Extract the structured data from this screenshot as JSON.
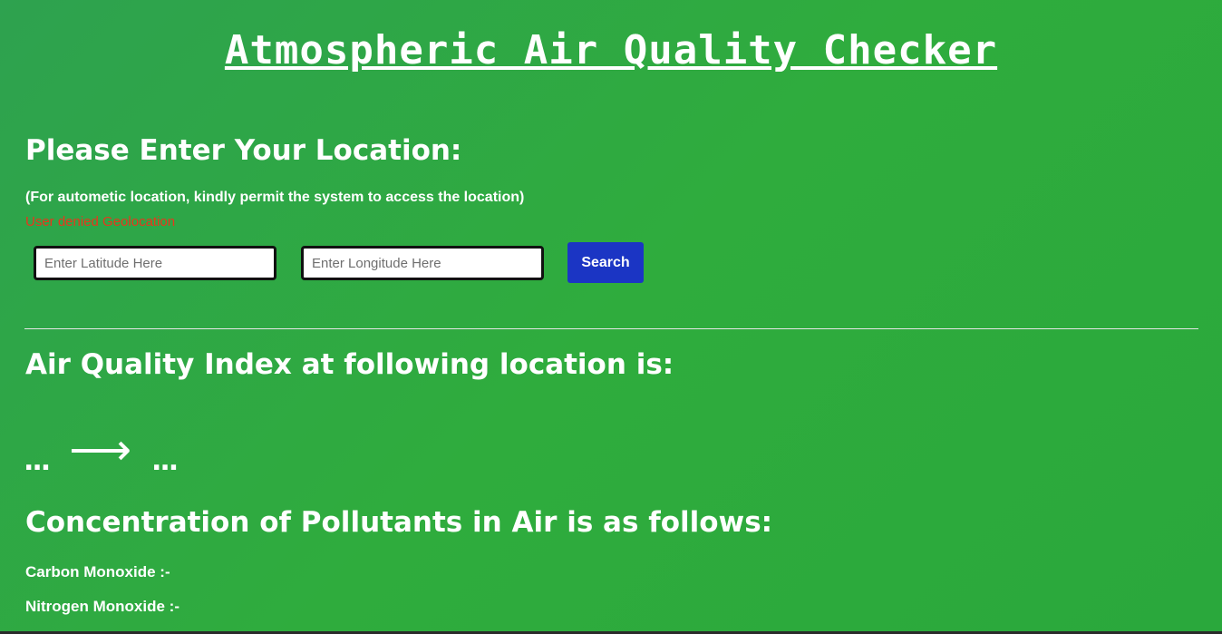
{
  "header": {
    "title": "Atmospheric Air Quality Checker"
  },
  "location": {
    "heading": "Please Enter Your Location:",
    "note": "(For autometic location, kindly permit the system to access the location)",
    "status": "User denied Geolocation",
    "latitude": {
      "value": "",
      "placeholder": "Enter Latitude Here"
    },
    "longitude": {
      "value": "",
      "placeholder": "Enter Longitude Here"
    },
    "search_label": "Search"
  },
  "aqi": {
    "heading": "Air Quality Index at following location is:",
    "value": "...",
    "arrow": "⟶",
    "category": "..."
  },
  "pollutants": {
    "heading": "Concentration of Pollutants in Air is as follows:",
    "items": [
      {
        "label": "Carbon Monoxide :-"
      },
      {
        "label": "Nitrogen Monoxide :-"
      }
    ]
  },
  "colors": {
    "background": "#2ea24f",
    "accent_button": "#1b35c4",
    "error_text": "#e8361c",
    "text": "#ffffff"
  }
}
